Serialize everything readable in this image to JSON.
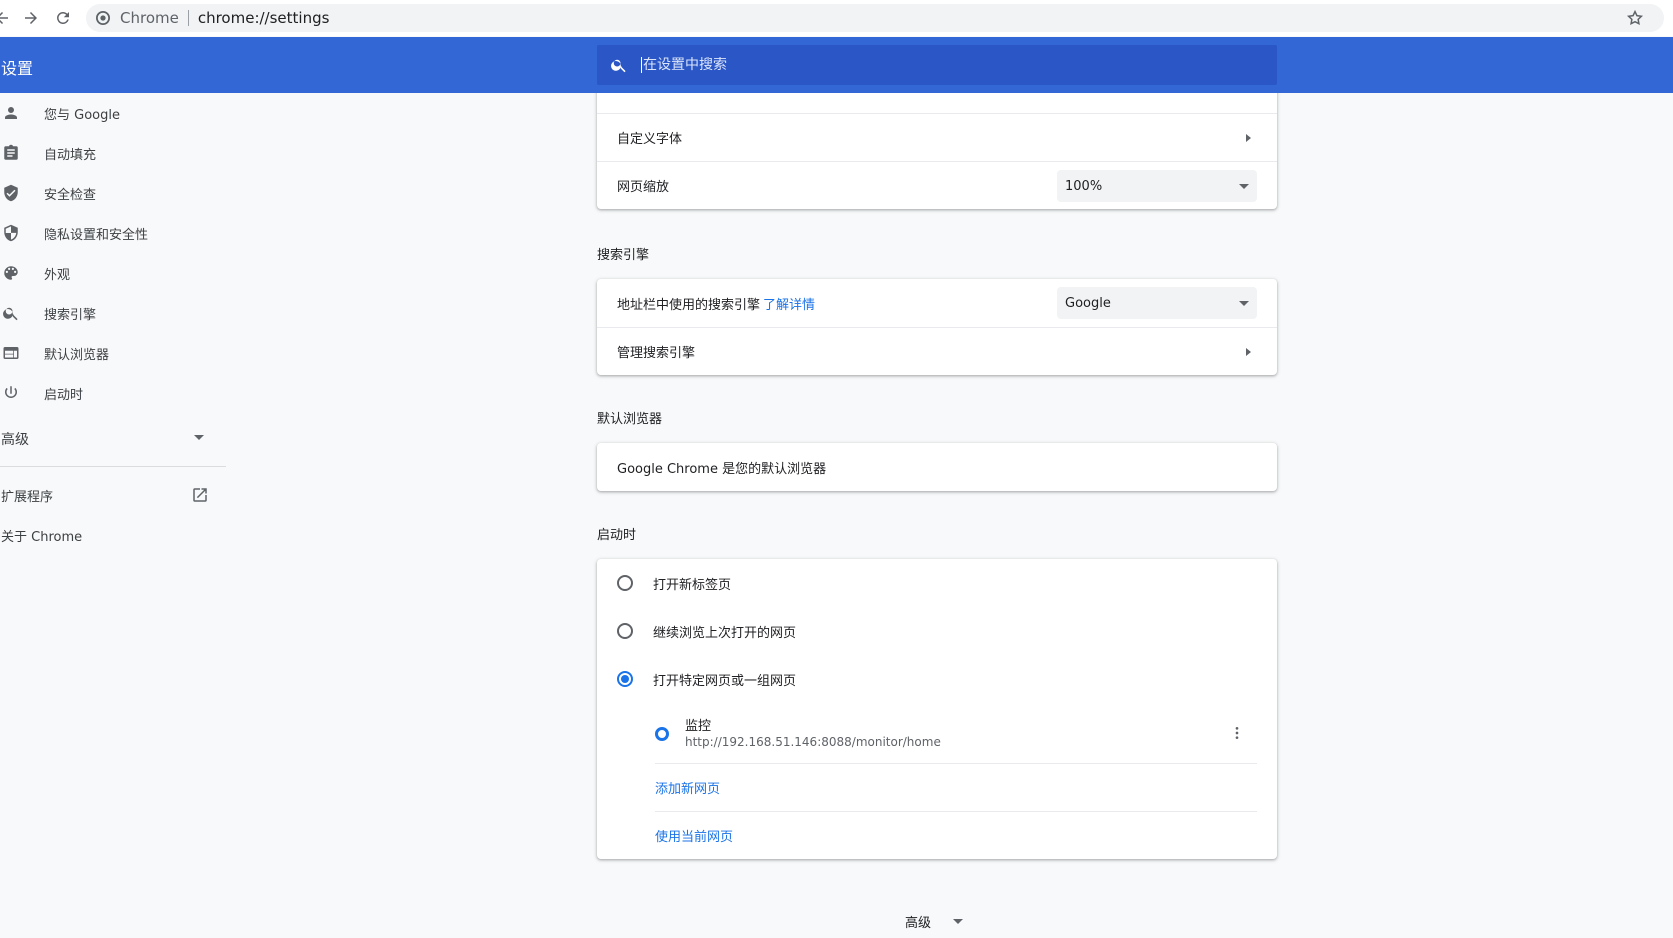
{
  "browser": {
    "site_name": "Chrome",
    "url": "chrome://settings"
  },
  "header": {
    "title": "设置",
    "search_placeholder": "在设置中搜索"
  },
  "sidebar": {
    "items": [
      {
        "label": "您与 Google",
        "icon": "person-icon"
      },
      {
        "label": "自动填充",
        "icon": "clipboard-icon"
      },
      {
        "label": "安全检查",
        "icon": "shield-check-icon"
      },
      {
        "label": "隐私设置和安全性",
        "icon": "shield-icon"
      },
      {
        "label": "外观",
        "icon": "palette-icon"
      },
      {
        "label": "搜索引擎",
        "icon": "search-icon"
      },
      {
        "label": "默认浏览器",
        "icon": "browser-icon"
      },
      {
        "label": "启动时",
        "icon": "power-icon"
      }
    ],
    "advanced_label": "高级",
    "extensions_label": "扩展程序",
    "about_label": "关于 Chrome"
  },
  "appearance": {
    "custom_fonts_label": "自定义字体",
    "page_zoom_label": "网页缩放",
    "page_zoom_value": "100%"
  },
  "search_engine": {
    "section_title": "搜索引擎",
    "engine_label": "地址栏中使用的搜索引擎",
    "learn_more": "了解详情",
    "engine_value": "Google",
    "manage_label": "管理搜索引擎"
  },
  "default_browser": {
    "section_title": "默认浏览器",
    "status": "Google Chrome 是您的默认浏览器"
  },
  "startup": {
    "section_title": "启动时",
    "options": [
      {
        "label": "打开新标签页",
        "selected": false
      },
      {
        "label": "继续浏览上次打开的网页",
        "selected": false
      },
      {
        "label": "打开特定网页或一组网页",
        "selected": true
      }
    ],
    "pages": [
      {
        "name": "监控",
        "url": "http://192.168.51.146:8088/monitor/home"
      }
    ],
    "add_page": "添加新网页",
    "use_current": "使用当前网页"
  },
  "footer": {
    "advanced_label": "高级"
  },
  "colors": {
    "accent": "#3367d6",
    "link": "#1a73e8"
  }
}
